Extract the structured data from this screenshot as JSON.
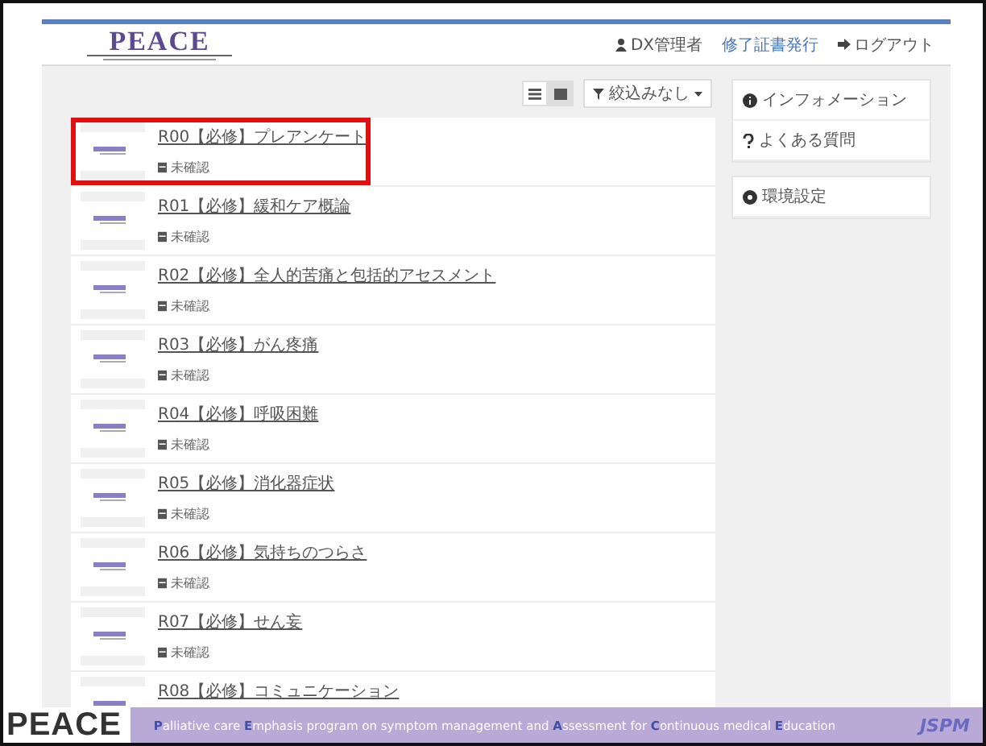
{
  "header": {
    "logo": "PEACE",
    "links": [
      {
        "kind": "user",
        "label": "DX管理者"
      },
      {
        "kind": "link",
        "label": "修了証書発行"
      },
      {
        "kind": "logout",
        "label": "ログアウト"
      }
    ]
  },
  "toolbar": {
    "views": [
      {
        "kind": "list",
        "selected": false
      },
      {
        "kind": "grid",
        "selected": true
      }
    ],
    "filter": "絞込みなし"
  },
  "courses": [
    {
      "title": "R00【必修】プレアンケート",
      "status": "未確認",
      "highlighted": true
    },
    {
      "title": "R01【必修】緩和ケア概論",
      "status": "未確認",
      "highlighted": false
    },
    {
      "title": "R02【必修】全人的苦痛と包括的アセスメント",
      "status": "未確認",
      "highlighted": false
    },
    {
      "title": "R03【必修】がん疼痛",
      "status": "未確認",
      "highlighted": false
    },
    {
      "title": "R04【必修】呼吸困難",
      "status": "未確認",
      "highlighted": false
    },
    {
      "title": "R05【必修】消化器症状",
      "status": "未確認",
      "highlighted": false
    },
    {
      "title": "R06【必修】気持ちのつらさ",
      "status": "未確認",
      "highlighted": false
    },
    {
      "title": "R07【必修】せん妄",
      "status": "未確認",
      "highlighted": false
    },
    {
      "title": "R08【必修】コミュニケーション",
      "highlighted": false
    }
  ],
  "sidebar": {
    "groups": [
      [
        {
          "kind": "info",
          "label": "インフォメーション"
        },
        {
          "kind": "faq",
          "label": "よくある質問"
        }
      ],
      [
        {
          "kind": "settings",
          "label": "環境設定"
        }
      ]
    ]
  },
  "footer": {
    "logo": "PEACE",
    "tagline": "**P**alliative care **E**mphasis program on symptom management and **A**ssessment for **C**ontinuous medical **E**ducation",
    "org": "JSPM"
  }
}
